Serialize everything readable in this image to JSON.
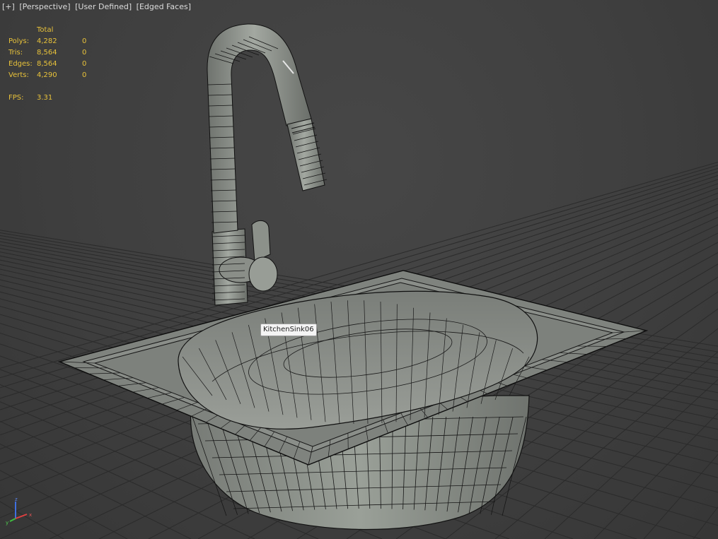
{
  "viewport_label": {
    "menu": "[+]",
    "view": "[Perspective]",
    "shading_preset": "[User Defined]",
    "shading_mode": "[Edged Faces]"
  },
  "stats": {
    "header": "Total",
    "rows": [
      {
        "label": "Polys:",
        "total": "4,282",
        "selected": "0"
      },
      {
        "label": "Tris:",
        "total": "8,564",
        "selected": "0"
      },
      {
        "label": "Edges:",
        "total": "8,564",
        "selected": "0"
      },
      {
        "label": "Verts:",
        "total": "4,290",
        "selected": "0"
      }
    ],
    "fps_label": "FPS:",
    "fps_value": "3.31"
  },
  "selected_object_tooltip": "KitchenSink06",
  "colors": {
    "viewport_bg": "#3f3f3f",
    "grid": "#2a2a2a",
    "stats_text": "#e8c23a",
    "model_face": "#8e928c",
    "model_edge": "#111111",
    "axis_x": "#e04040",
    "axis_y": "#3fbf3f",
    "axis_z": "#3f6fe0"
  },
  "axis_gizmo": {
    "x": "x",
    "y": "y",
    "z": "z"
  }
}
